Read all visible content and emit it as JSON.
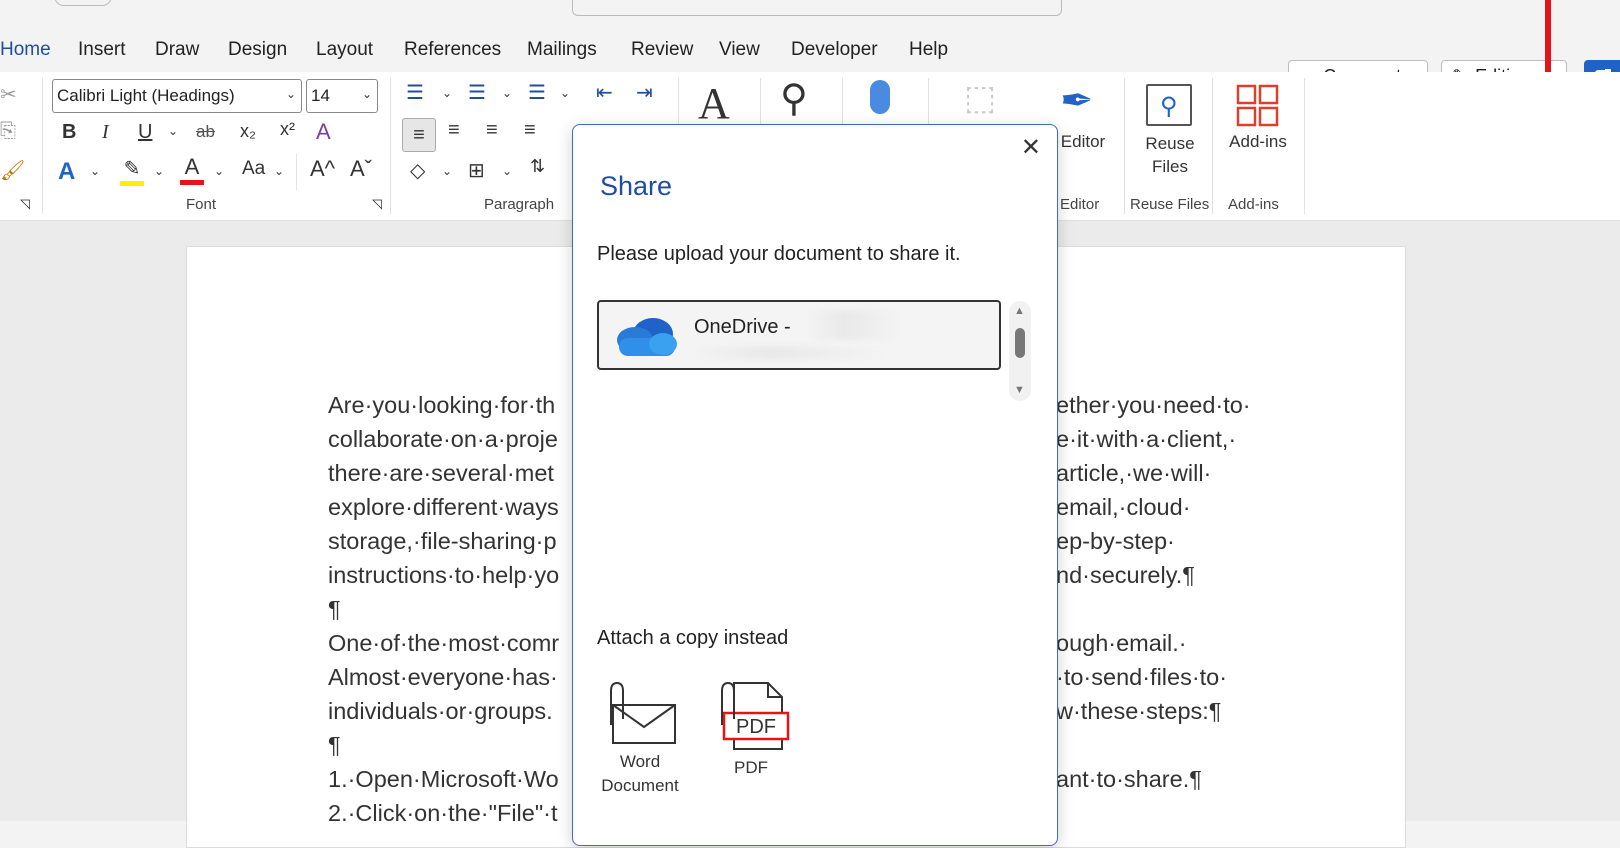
{
  "ribbon_tabs": [
    "Home",
    "Insert",
    "Draw",
    "Design",
    "Layout",
    "References",
    "Mailings",
    "Review",
    "View",
    "Developer",
    "Help"
  ],
  "active_tab": "Home",
  "top_buttons": {
    "comments": "Comments",
    "editing": "Editing"
  },
  "font": {
    "name": "Calibri Light (Headings)",
    "size": "14"
  },
  "group_labels": {
    "font": "Font",
    "paragraph": "Paragraph",
    "editor": "Editor",
    "reuse_files": "Reuse Files",
    "addins": "Add-ins"
  },
  "big_buttons": {
    "editor": "Editor",
    "reuse_files": "Reuse\nFiles",
    "addins": "Add-ins"
  },
  "font_buttons": {
    "bold": "B",
    "italic": "I",
    "underline": "U",
    "strike": "ab",
    "subscript": "x₂",
    "superscript": "x²",
    "case": "Aa",
    "grow": "A^",
    "shrink": "Aˇ"
  },
  "document_lines": [
    "Are·you·looking·for·th",
    "collaborate·on·a·proje",
    "there·are·several·met",
    "explore·different·ways",
    "storage,·file-sharing·p",
    "instructions·to·help·yo",
    "¶",
    "One·of·the·most·comr",
    "Almost·everyone·has·",
    "individuals·or·groups.",
    "¶",
    "1.·Open·Microsoft·Wo",
    "2.·Click·on·the·\"File\"·t"
  ],
  "document_lines_right": [
    "ether·you·need·to·",
    "e·it·with·a·client,·",
    "article,·we·will·",
    "email,·cloud·",
    "ep-by-step·",
    "nd·securely.¶",
    "",
    "ough·email.·",
    "·to·send·files·to·",
    "w·these·steps:¶",
    "",
    "ant·to·share.¶",
    ""
  ],
  "dialog": {
    "title": "Share",
    "description": "Please upload your document to share it.",
    "location_name": "OneDrive -",
    "attach_heading": "Attach a copy instead",
    "attach_options": [
      {
        "label": "Word\nDocument",
        "icon": "word-attachment-icon"
      },
      {
        "label": "PDF",
        "icon": "pdf-attachment-icon",
        "badge": "PDF"
      }
    ]
  },
  "colors": {
    "accent": "#1f4e9d",
    "share_button": "#1f62c8",
    "highlight": "#e3151a",
    "onedrive": "#2a7bd8"
  }
}
